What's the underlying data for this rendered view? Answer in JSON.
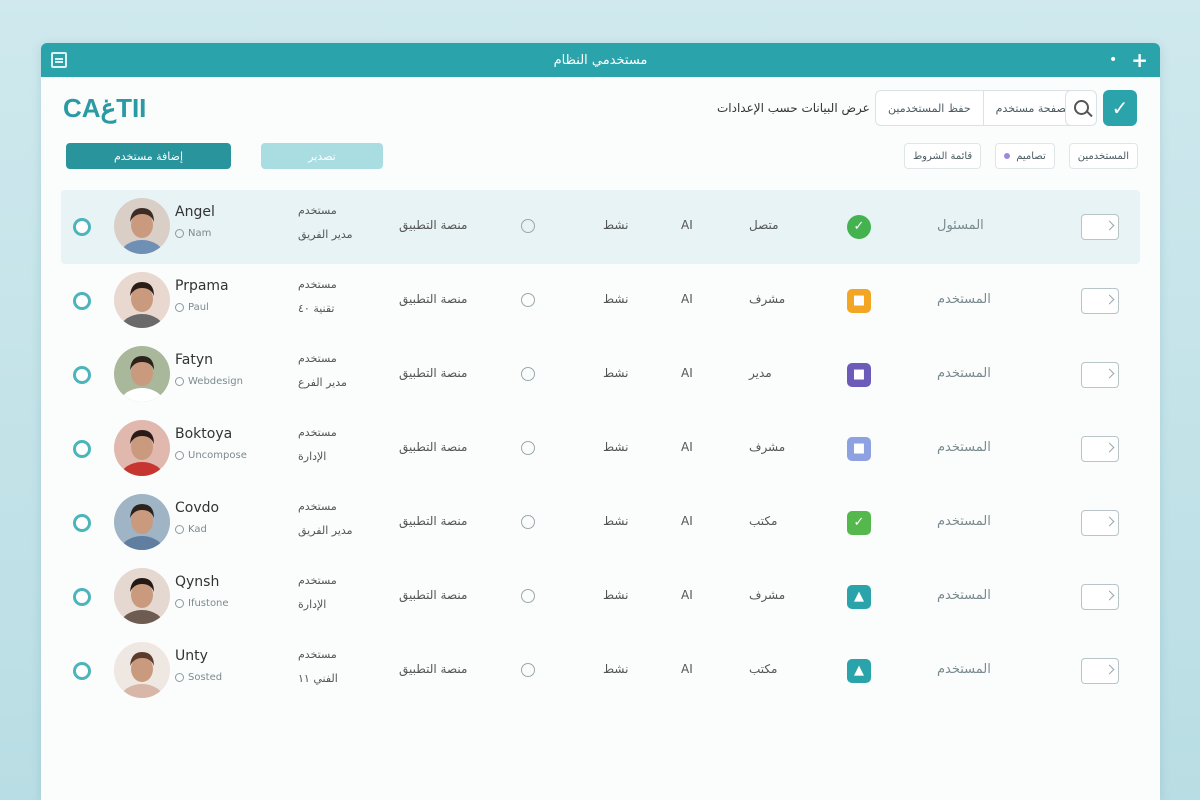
{
  "window": {
    "title": "مستخدمي النظام"
  },
  "toolbar": {
    "brand": "CAغTII",
    "hint": "عرض البيانات حسب الإعدادات",
    "seg_buttons": [
      "حفظ المستخدمين",
      "الصفحة مستخدم"
    ],
    "search_icon": "search-icon",
    "confirm_icon": "check-icon"
  },
  "actions": {
    "primary_label": "إضافة مستخدم",
    "secondary_label": "تصدير"
  },
  "filters": [
    {
      "label": "المستخدمين"
    },
    {
      "label": "تصاميم"
    },
    {
      "label": "قائمة الشروط"
    }
  ],
  "rows": [
    {
      "name": "Angel",
      "sub": "Nam",
      "col2a": "مستخدم",
      "col2b": "مدير الفريق",
      "c3": "منصة التطبيق",
      "c5": "نشط",
      "c6": "AI",
      "c7": "متصل",
      "status_color": "#44b34f",
      "status_glyph": "✓",
      "c9": "المسئول",
      "selected": true
    },
    {
      "name": "Prpama",
      "sub": "Paul",
      "col2a": "مستخدم",
      "col2b": "تقنية ٤٠",
      "c3": "منصة التطبيق",
      "c5": "نشط",
      "c6": "AI",
      "c7": "مشرف",
      "status_color": "#f2a623",
      "status_glyph": "■",
      "c9": "المستخدم",
      "selected": false
    },
    {
      "name": "Fatyn",
      "sub": "Webdesign",
      "col2a": "مستخدم",
      "col2b": "مدير الفرع",
      "c3": "منصة التطبيق",
      "c5": "نشط",
      "c6": "AI",
      "c7": "مدير",
      "status_color": "#6c5bb8",
      "status_glyph": "■",
      "c9": "المستخدم",
      "selected": false
    },
    {
      "name": "Boktoya",
      "sub": "Uncompose",
      "col2a": "مستخدم",
      "col2b": "الإدارة",
      "c3": "منصة التطبيق",
      "c5": "نشط",
      "c6": "AI",
      "c7": "مشرف",
      "status_color": "#8ea1e0",
      "status_glyph": "■",
      "c9": "المستخدم",
      "selected": false
    },
    {
      "name": "Covdo",
      "sub": "Kad",
      "col2a": "مستخدم",
      "col2b": "مدير الفريق",
      "c3": "منصة التطبيق",
      "c5": "نشط",
      "c6": "AI",
      "c7": "مكتب",
      "status_color": "#55b84c",
      "status_glyph": "✓",
      "c9": "المستخدم",
      "selected": false
    },
    {
      "name": "Qynsh",
      "sub": "Ifustone",
      "col2a": "مستخدم",
      "col2b": "الإدارة",
      "c3": "منصة التطبيق",
      "c5": "نشط",
      "c6": "AI",
      "c7": "مشرف",
      "status_color": "#2aa3ab",
      "status_glyph": "▲",
      "c9": "المستخدم",
      "selected": false
    },
    {
      "name": "Unty",
      "sub": "Sosted",
      "col2a": "مستخدم",
      "col2b": "الفني ١١",
      "c3": "منصة التطبيق",
      "c5": "نشط",
      "c6": "AI",
      "c7": "مكتب",
      "status_color": "#2aa3ab",
      "status_glyph": "▲",
      "c9": "المستخدم",
      "selected": false
    }
  ]
}
